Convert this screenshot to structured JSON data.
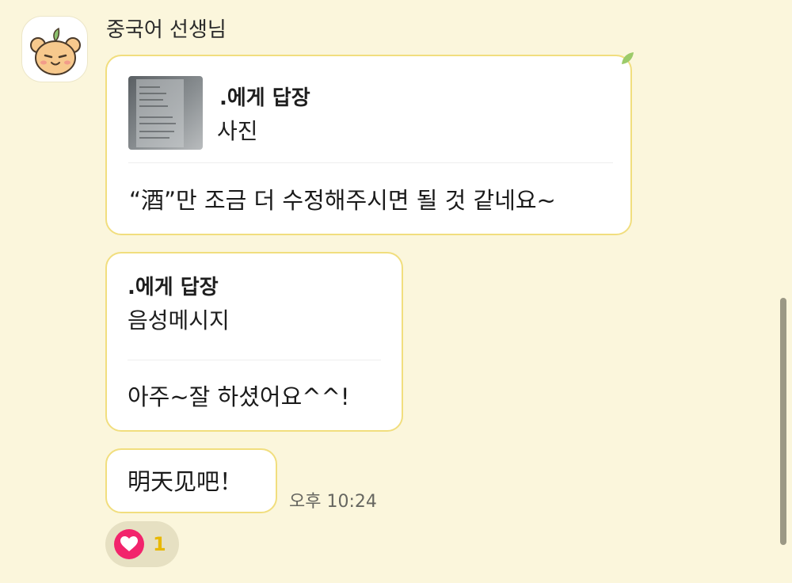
{
  "sender": {
    "name": "중국어 선생님",
    "avatar_icon": "bear-face-icon"
  },
  "messages": [
    {
      "reply_to": ".에게 답장",
      "reply_type": "사진",
      "text": "“酒”만 조금 더 수정해주시면 될 것 같네요~"
    },
    {
      "reply_to": ".에게 답장",
      "reply_type": "음성메시지",
      "text": "아주~잘 하셨어요^^!"
    },
    {
      "text": "明天见吧！",
      "time": "오후 10:24"
    }
  ],
  "reaction": {
    "icon": "heart-icon",
    "count": "1"
  },
  "colors": {
    "background": "#FBF6DC",
    "bubble_border": "#F1DE7E",
    "reaction_heart": "#F2246C",
    "reaction_count": "#E8B800"
  }
}
